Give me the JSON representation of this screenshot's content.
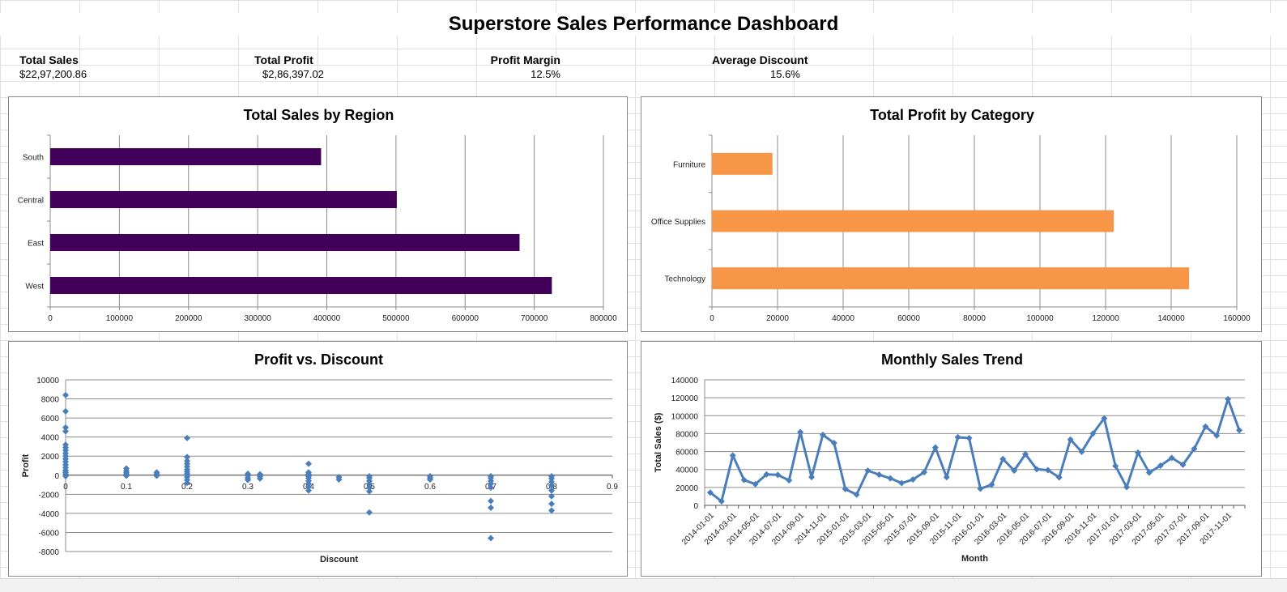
{
  "dashboard": {
    "title": "Superstore Sales Performance Dashboard",
    "kpis": [
      {
        "label": "Total Sales",
        "value": "$22,97,200.86"
      },
      {
        "label": "Total Profit",
        "value": "$2,86,397.02"
      },
      {
        "label": "Profit Margin",
        "value": "12.5%"
      },
      {
        "label": "Average Discount",
        "value": "15.6%"
      }
    ]
  },
  "colors": {
    "region_bar": "#43005a",
    "category_bar": "#f79646",
    "series_blue": "#4a7ebb",
    "grid": "#8c8c8c"
  },
  "chart_data": [
    {
      "type": "bar",
      "title": "Total Sales by Region",
      "orientation": "horizontal",
      "categories": [
        "South",
        "Central",
        "East",
        "West"
      ],
      "values": [
        391722,
        501240,
        678781,
        725458
      ],
      "xlim": [
        0,
        800000
      ],
      "xticks": [
        0,
        100000,
        200000,
        300000,
        400000,
        500000,
        600000,
        700000,
        800000
      ],
      "color": "#43005a",
      "grid": true
    },
    {
      "type": "bar",
      "title": "Total Profit by Category",
      "orientation": "horizontal",
      "categories": [
        "Furniture",
        "Office Supplies",
        "Technology"
      ],
      "values": [
        18451,
        122491,
        145455
      ],
      "xlim": [
        0,
        160000
      ],
      "xticks": [
        0,
        20000,
        40000,
        60000,
        80000,
        100000,
        120000,
        140000,
        160000
      ],
      "color": "#f79646",
      "grid": true
    },
    {
      "type": "scatter",
      "title": "Profit vs. Discount",
      "xlabel": "Discount",
      "ylabel": "Profit",
      "xlim": [
        0,
        0.9
      ],
      "ylim": [
        -8000,
        10000
      ],
      "xticks": [
        0,
        0.1,
        0.2,
        0.3,
        0.4,
        0.5,
        0.6,
        0.7,
        0.8,
        0.9
      ],
      "yticks": [
        -8000,
        -6000,
        -4000,
        -2000,
        0,
        2000,
        4000,
        6000,
        8000,
        10000
      ],
      "color": "#4a7ebb",
      "points": [
        [
          0,
          8400
        ],
        [
          0,
          6700
        ],
        [
          0,
          5000
        ],
        [
          0,
          4600
        ],
        [
          0,
          3200
        ],
        [
          0,
          2900
        ],
        [
          0,
          2600
        ],
        [
          0,
          2300
        ],
        [
          0,
          2000
        ],
        [
          0,
          1700
        ],
        [
          0,
          1400
        ],
        [
          0,
          1100
        ],
        [
          0,
          800
        ],
        [
          0,
          500
        ],
        [
          0,
          300
        ],
        [
          0,
          100
        ],
        [
          0,
          -100
        ],
        [
          0.1,
          700
        ],
        [
          0.1,
          450
        ],
        [
          0.1,
          250
        ],
        [
          0.1,
          80
        ],
        [
          0.1,
          -60
        ],
        [
          0.15,
          300
        ],
        [
          0.15,
          120
        ],
        [
          0.15,
          -60
        ],
        [
          0.2,
          3900
        ],
        [
          0.2,
          1900
        ],
        [
          0.2,
          1500
        ],
        [
          0.2,
          1200
        ],
        [
          0.2,
          900
        ],
        [
          0.2,
          600
        ],
        [
          0.2,
          350
        ],
        [
          0.2,
          150
        ],
        [
          0.2,
          0
        ],
        [
          0.2,
          -200
        ],
        [
          0.2,
          -500
        ],
        [
          0.2,
          -800
        ],
        [
          0.3,
          150
        ],
        [
          0.3,
          -50
        ],
        [
          0.3,
          -300
        ],
        [
          0.3,
          -500
        ],
        [
          0.32,
          100
        ],
        [
          0.32,
          -150
        ],
        [
          0.32,
          -350
        ],
        [
          0.4,
          1200
        ],
        [
          0.4,
          300
        ],
        [
          0.4,
          100
        ],
        [
          0.4,
          -100
        ],
        [
          0.4,
          -300
        ],
        [
          0.4,
          -600
        ],
        [
          0.4,
          -900
        ],
        [
          0.4,
          -1200
        ],
        [
          0.4,
          -1600
        ],
        [
          0.45,
          -200
        ],
        [
          0.45,
          -450
        ],
        [
          0.5,
          -100
        ],
        [
          0.5,
          -300
        ],
        [
          0.5,
          -600
        ],
        [
          0.5,
          -900
        ],
        [
          0.5,
          -1300
        ],
        [
          0.5,
          -1700
        ],
        [
          0.5,
          -3900
        ],
        [
          0.6,
          -100
        ],
        [
          0.6,
          -300
        ],
        [
          0.6,
          -450
        ],
        [
          0.7,
          -100
        ],
        [
          0.7,
          -300
        ],
        [
          0.7,
          -600
        ],
        [
          0.7,
          -900
        ],
        [
          0.7,
          -1300
        ],
        [
          0.7,
          -2700
        ],
        [
          0.7,
          -3400
        ],
        [
          0.7,
          -6600
        ],
        [
          0.8,
          -100
        ],
        [
          0.8,
          -350
        ],
        [
          0.8,
          -700
        ],
        [
          0.8,
          -1100
        ],
        [
          0.8,
          -1600
        ],
        [
          0.8,
          -2200
        ],
        [
          0.8,
          -3000
        ],
        [
          0.8,
          -3700
        ]
      ]
    },
    {
      "type": "line",
      "title": "Monthly Sales Trend",
      "xlabel": "Month",
      "ylabel": "Total Sales ($)",
      "ylim": [
        0,
        140000
      ],
      "yticks": [
        0,
        20000,
        40000,
        60000,
        80000,
        100000,
        120000,
        140000
      ],
      "color": "#4a7ebb",
      "x": [
        "2014-01-01",
        "2014-02-01",
        "2014-03-01",
        "2014-04-01",
        "2014-05-01",
        "2014-06-01",
        "2014-07-01",
        "2014-08-01",
        "2014-09-01",
        "2014-10-01",
        "2014-11-01",
        "2014-12-01",
        "2015-01-01",
        "2015-02-01",
        "2015-03-01",
        "2015-04-01",
        "2015-05-01",
        "2015-06-01",
        "2015-07-01",
        "2015-08-01",
        "2015-09-01",
        "2015-10-01",
        "2015-11-01",
        "2015-12-01",
        "2016-01-01",
        "2016-02-01",
        "2016-03-01",
        "2016-04-01",
        "2016-05-01",
        "2016-06-01",
        "2016-07-01",
        "2016-08-01",
        "2016-09-01",
        "2016-10-01",
        "2016-11-01",
        "2016-12-01",
        "2017-01-01",
        "2017-02-01",
        "2017-03-01",
        "2017-04-01",
        "2017-05-01",
        "2017-06-01",
        "2017-07-01",
        "2017-08-01",
        "2017-09-01",
        "2017-10-01",
        "2017-11-01",
        "2017-12-01"
      ],
      "tick_labels": [
        "2014-01-01",
        "2014-03-01",
        "2014-05-01",
        "2014-07-01",
        "2014-09-01",
        "2014-11-01",
        "2015-01-01",
        "2015-03-01",
        "2015-05-01",
        "2015-07-01",
        "2015-09-01",
        "2015-11-01",
        "2016-01-01",
        "2016-03-01",
        "2016-05-01",
        "2016-07-01",
        "2016-09-01",
        "2016-11-01",
        "2017-01-01",
        "2017-03-01",
        "2017-05-01",
        "2017-07-01",
        "2017-09-01",
        "2017-11-01"
      ],
      "values": [
        14237,
        4520,
        55691,
        28295,
        23648,
        34595,
        33946,
        27909,
        81777,
        31453,
        78629,
        69546,
        18174,
        11951,
        38726,
        34195,
        30132,
        24797,
        28765,
        36898,
        64596,
        31405,
        75973,
        74919,
        18542,
        22979,
        51716,
        38750,
        56988,
        40344,
        39262,
        31115,
        73410,
        59688,
        80015,
        96999,
        43971,
        20301,
        58872,
        36522,
        44261,
        52982,
        45264,
        63121,
        87867,
        77777,
        118448,
        83829
      ]
    }
  ]
}
